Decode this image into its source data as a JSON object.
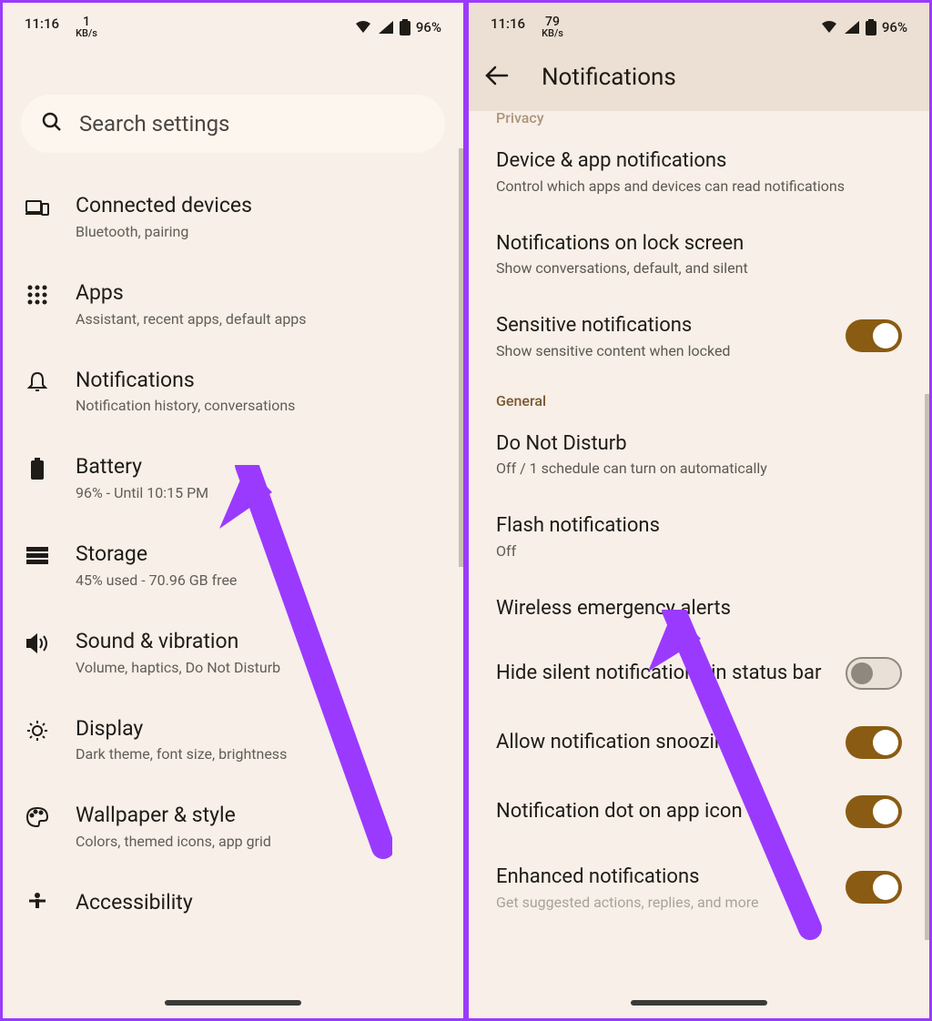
{
  "left": {
    "status": {
      "time": "11:16",
      "speed_num": "1",
      "speed_unit": "KB/s",
      "battery": "96%"
    },
    "search_placeholder": "Search settings",
    "items": [
      {
        "icon": "devices",
        "title": "Connected devices",
        "subtitle": "Bluetooth, pairing"
      },
      {
        "icon": "apps",
        "title": "Apps",
        "subtitle": "Assistant, recent apps, default apps"
      },
      {
        "icon": "bell",
        "title": "Notifications",
        "subtitle": "Notification history, conversations"
      },
      {
        "icon": "battery",
        "title": "Battery",
        "subtitle": "96% - Until 10:15 PM"
      },
      {
        "icon": "storage",
        "title": "Storage",
        "subtitle": "45% used - 70.96 GB free"
      },
      {
        "icon": "sound",
        "title": "Sound & vibration",
        "subtitle": "Volume, haptics, Do Not Disturb"
      },
      {
        "icon": "display",
        "title": "Display",
        "subtitle": "Dark theme, font size, brightness"
      },
      {
        "icon": "wallpaper",
        "title": "Wallpaper & style",
        "subtitle": "Colors, themed icons, app grid"
      },
      {
        "icon": "accessibility",
        "title": "Accessibility",
        "subtitle": ""
      }
    ]
  },
  "right": {
    "status": {
      "time": "11:16",
      "speed_num": "79",
      "speed_unit": "KB/s",
      "battery": "96%"
    },
    "header_title": "Notifications",
    "section_privacy": "Privacy",
    "section_general": "General",
    "items_privacy": [
      {
        "title": "Device & app notifications",
        "subtitle": "Control which apps and devices can read notifications",
        "toggle": null
      },
      {
        "title": "Notifications on lock screen",
        "subtitle": "Show conversations, default, and silent",
        "toggle": null
      },
      {
        "title": "Sensitive notifications",
        "subtitle": "Show sensitive content when locked",
        "toggle": "on"
      }
    ],
    "items_general": [
      {
        "title": "Do Not Disturb",
        "subtitle": "Off / 1 schedule can turn on automatically",
        "toggle": null
      },
      {
        "title": "Flash notifications",
        "subtitle": "Off",
        "toggle": null
      },
      {
        "title": "Wireless emergency alerts",
        "subtitle": "",
        "toggle": null
      },
      {
        "title": "Hide silent notifications in status bar",
        "subtitle": "",
        "toggle": "off"
      },
      {
        "title": "Allow notification snoozing",
        "subtitle": "",
        "toggle": "on"
      },
      {
        "title": "Notification dot on app icon",
        "subtitle": "",
        "toggle": "on"
      },
      {
        "title": "Enhanced notifications",
        "subtitle": "Get suggested actions, replies, and more",
        "toggle": "on"
      }
    ]
  }
}
